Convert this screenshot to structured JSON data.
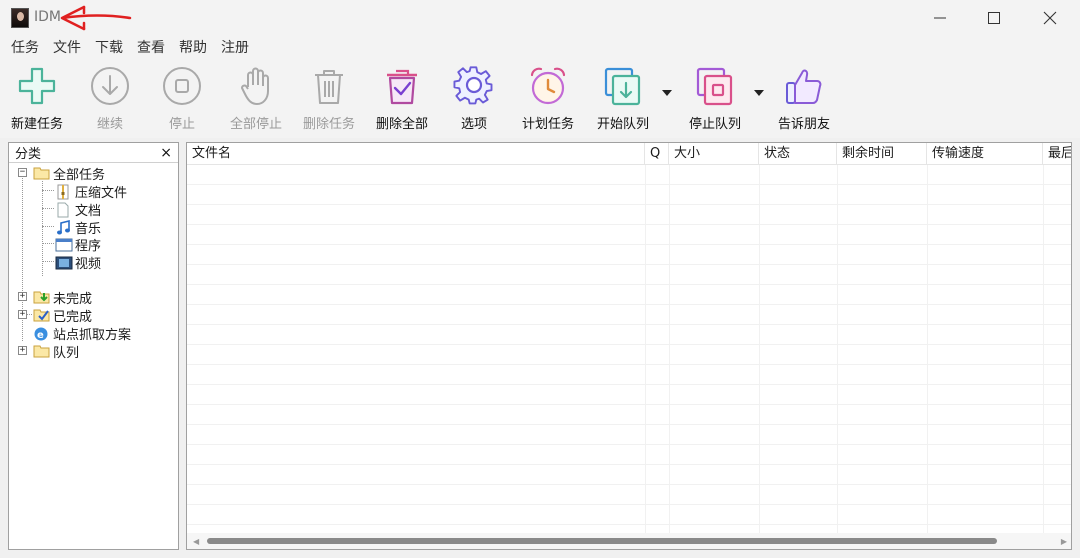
{
  "window": {
    "title": "IDM",
    "controls": [
      "minimize-icon",
      "maximize-icon",
      "close-icon"
    ]
  },
  "menu": [
    "任务",
    "文件",
    "下载",
    "查看",
    "帮助",
    "注册"
  ],
  "toolbar": {
    "buttons": [
      {
        "label": "新建任务",
        "icon": "add-icon",
        "enabled": true
      },
      {
        "label": "继续",
        "icon": "resume-icon",
        "enabled": false
      },
      {
        "label": "停止",
        "icon": "stop-icon",
        "enabled": false
      },
      {
        "label": "全部停止",
        "icon": "hand-icon",
        "enabled": false
      },
      {
        "label": "删除任务",
        "icon": "trash-icon",
        "enabled": false
      },
      {
        "label": "删除全部",
        "icon": "delete-all-icon",
        "enabled": true
      },
      {
        "label": "选项",
        "icon": "gear-icon",
        "enabled": true
      },
      {
        "label": "计划任务",
        "icon": "alarm-clock-icon",
        "enabled": true
      },
      {
        "label": "开始队列",
        "icon": "start-queue-icon",
        "enabled": true
      },
      {
        "label": "停止队列",
        "icon": "stop-queue-icon",
        "enabled": true
      },
      {
        "label": "告诉朋友",
        "icon": "thumbs-up-icon",
        "enabled": true
      }
    ]
  },
  "sidebar": {
    "header": "分类",
    "close": "×",
    "tree": {
      "all": "全部任务",
      "all_children": [
        "压缩文件",
        "文档",
        "音乐",
        "程序",
        "视频"
      ],
      "unfinished": "未完成",
      "finished": "已完成",
      "grabber": "站点抓取方案",
      "queues": "队列"
    }
  },
  "list": {
    "columns": [
      "文件名",
      "Q",
      "大小",
      "状态",
      "剩余时间",
      "传输速度",
      "最后"
    ]
  },
  "colors": {
    "accent_green": "#4bb39a",
    "accent_purple": "#6a5bd7",
    "accent_pink": "#d9508a",
    "disabled": "#a9a9a9",
    "annotation_arrow": "#e02020"
  }
}
